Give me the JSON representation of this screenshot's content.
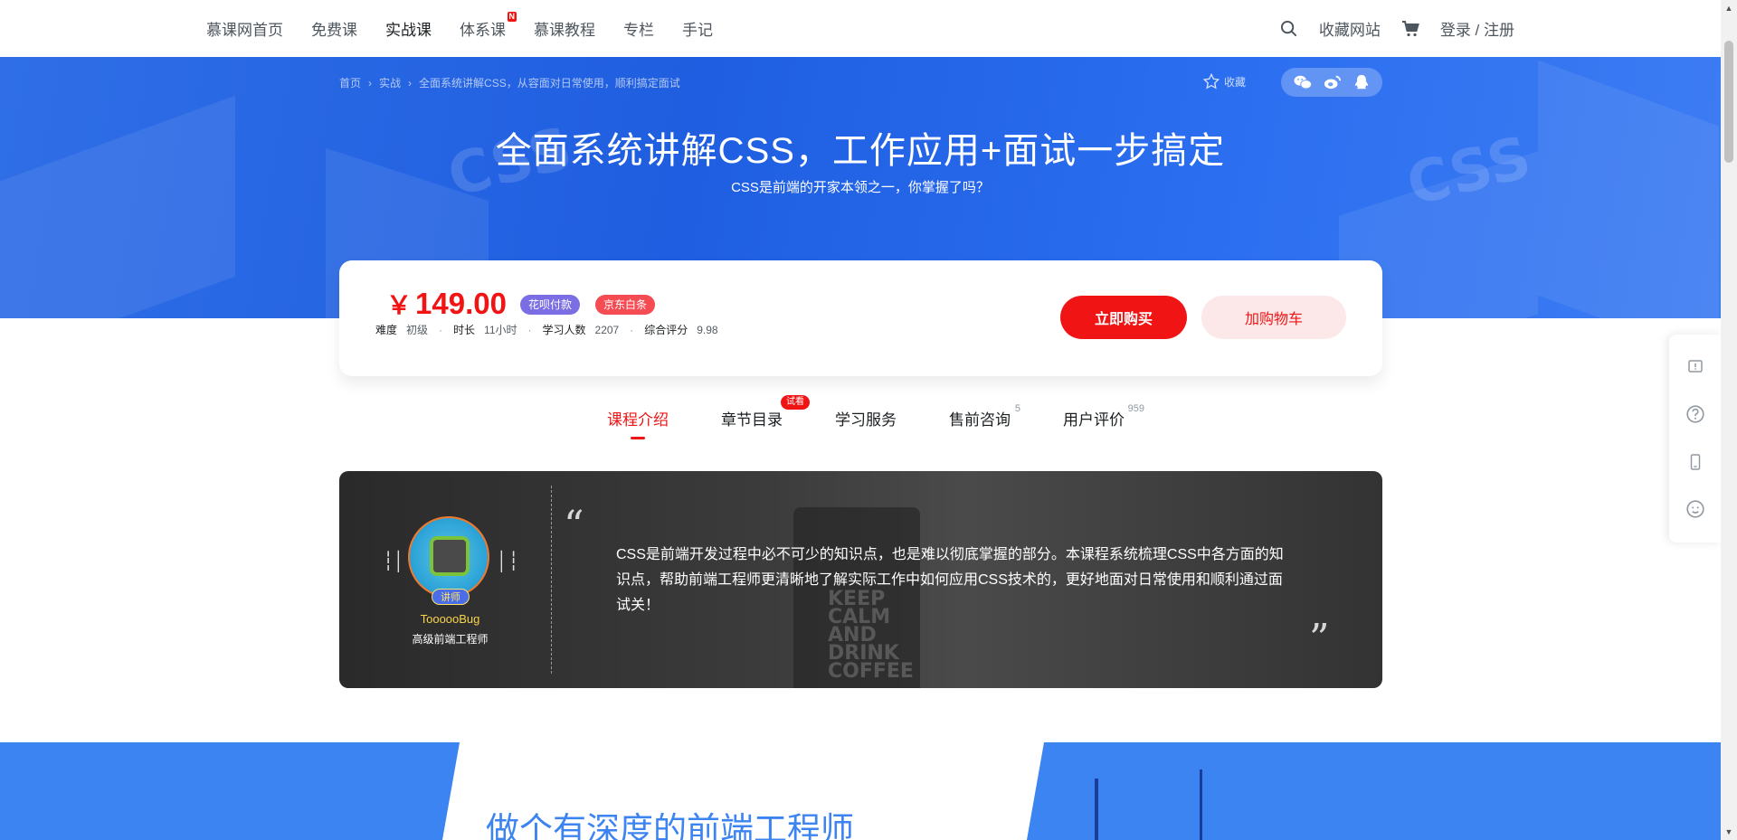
{
  "nav": {
    "items": [
      {
        "label": "慕课网首页"
      },
      {
        "label": "免费课"
      },
      {
        "label": "实战课"
      },
      {
        "label": "体系课",
        "badge": "N"
      },
      {
        "label": "慕课教程"
      },
      {
        "label": "专栏"
      },
      {
        "label": "手记"
      }
    ],
    "bookmark": "收藏网站",
    "login": "登录 / 注册"
  },
  "breadcrumb": [
    "首页",
    "实战",
    "全面系统讲解CSS，从容面对日常使用，顺利搞定面试"
  ],
  "collect_label": "收藏",
  "hero": {
    "title": "全面系统讲解CSS，工作应用+面试一步搞定",
    "subtitle": "CSS是前端的开家本领之一，你掌握了吗？"
  },
  "price_card": {
    "yen": "￥",
    "price": "149.00",
    "tags": {
      "huabei": "花呗付款",
      "jd": "京东白条"
    },
    "stats": [
      {
        "k": "难度",
        "v": "初级"
      },
      {
        "k": "时长",
        "v": "11小时"
      },
      {
        "k": "学习人数",
        "v": "2207"
      },
      {
        "k": "综合评分",
        "v": "9.98"
      }
    ],
    "buy": "立即购买",
    "cart": "加购物车"
  },
  "tabs": [
    {
      "label": "课程介绍"
    },
    {
      "label": "章节目录",
      "badge": "试看"
    },
    {
      "label": "学习服务"
    },
    {
      "label": "售前咨询",
      "sup": "5"
    },
    {
      "label": "用户评价",
      "sup": "959"
    }
  ],
  "intro": {
    "lecturer_tag": "讲师",
    "teacher_name": "ToooooBug",
    "teacher_title": "高级前端工程师",
    "quote_open": "“",
    "quote_close": "”",
    "text": "CSS是前端开发过程中必不可少的知识点，也是难以彻底掌握的部分。本课程系统梳理CSS中各方面的知识点，帮助前端工程师更清晰地了解实际工作中如何应用CSS技术的，更好地面对日常使用和顺利通过面试关！",
    "mug_text": "KEEP CALM AND DRINK COFFEE"
  },
  "bottom": {
    "heading": "做个有深度的前端工程师"
  },
  "colors": {
    "brand_red": "#f01414",
    "hero_blue": "#1f5ee0",
    "section_blue": "#3c84f2"
  },
  "icons": [
    "search-icon",
    "cart-icon",
    "star-icon",
    "wechat-icon",
    "weibo-icon",
    "qq-icon",
    "feedback-icon",
    "help-icon",
    "mobile-icon",
    "smile-icon"
  ]
}
